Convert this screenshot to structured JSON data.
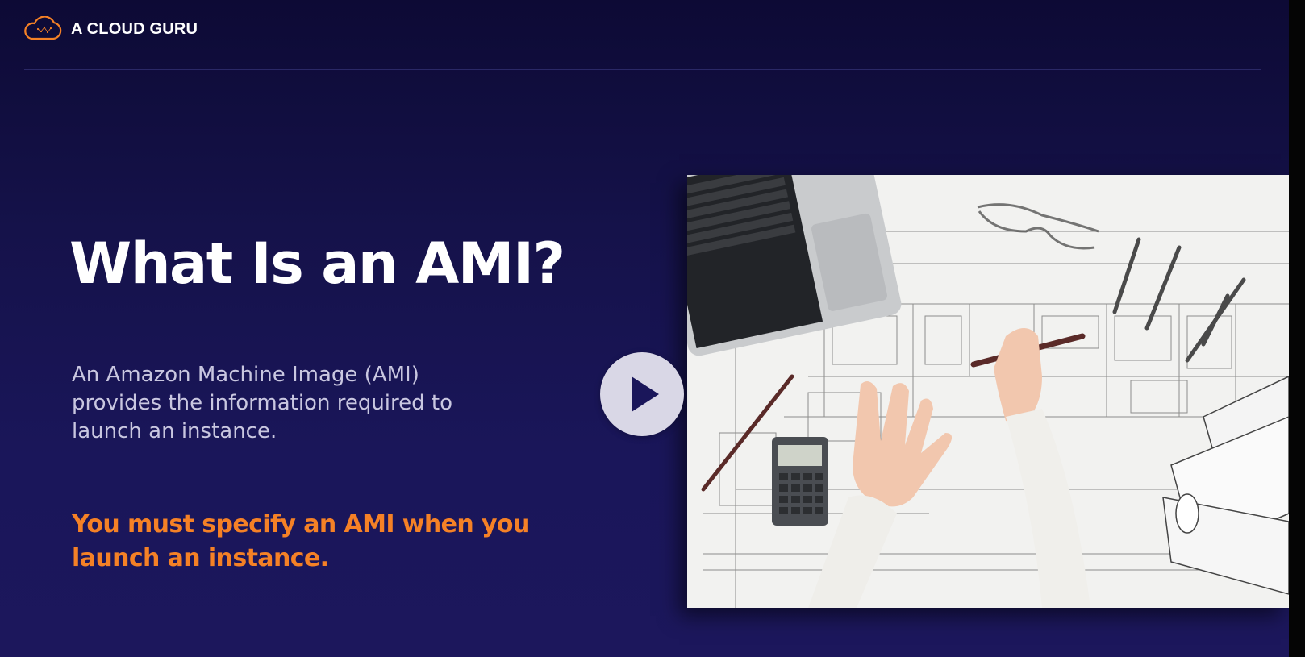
{
  "header": {
    "brand": "A CLOUD GURU",
    "logo_icon": "cloud-guru-logo-icon"
  },
  "slide": {
    "title": "What Is an AMI?",
    "description": "An Amazon Machine Image (AMI) provides the information required to launch an instance.",
    "highlight": "You must specify an AMI when you launch an instance."
  },
  "video": {
    "play_icon": "play-icon"
  },
  "colors": {
    "background": "#15124a",
    "title": "#ffffff",
    "description": "#c9c7e0",
    "accent": "#f58126",
    "play_button": "#d9d7e6"
  }
}
